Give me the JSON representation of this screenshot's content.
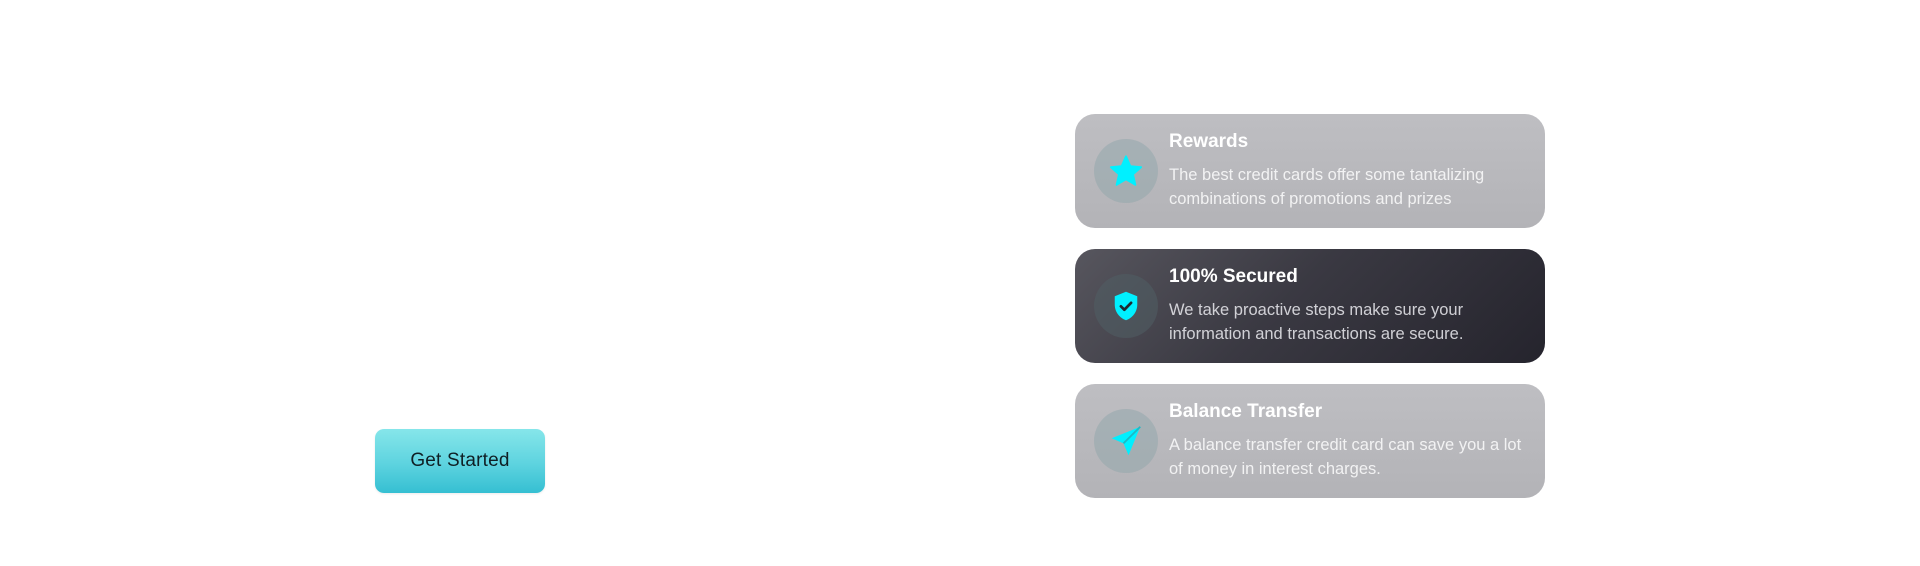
{
  "cta": {
    "label": "Get Started"
  },
  "features": [
    {
      "title": "Rewards",
      "description": "The best credit cards offer some tantalizing combinations of promotions and prizes",
      "icon": "star-icon",
      "active": false
    },
    {
      "title": "100% Secured",
      "description": "We take proactive steps make sure your information and transactions are secure.",
      "icon": "shield-check-icon",
      "active": true
    },
    {
      "title": "Balance Transfer",
      "description": "A balance transfer credit card can save you a lot of money in interest charges.",
      "icon": "send-icon",
      "active": false
    }
  ],
  "colors": {
    "accent": "#00f0ff",
    "cta_gradient_top": "#86e6ea",
    "cta_gradient_bottom": "#35bfd2",
    "card_inactive": "#b8b8bc",
    "card_active": "#2f2e37"
  }
}
